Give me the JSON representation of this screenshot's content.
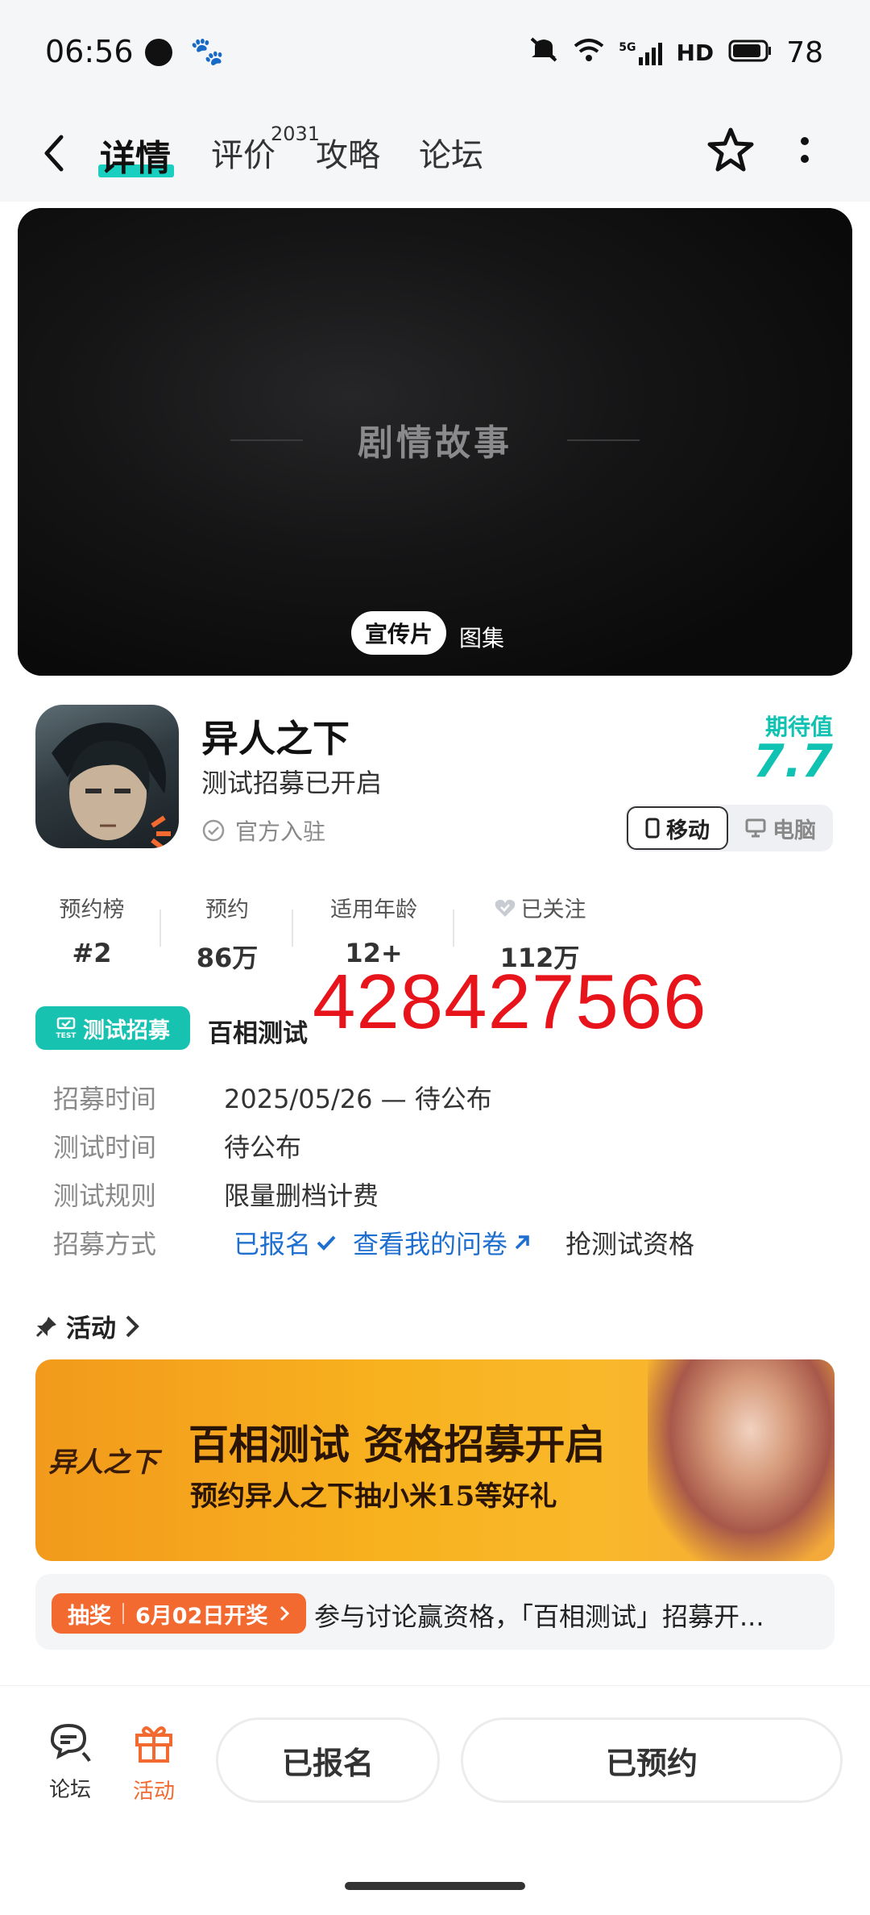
{
  "status_bar": {
    "time": "06:56",
    "network": "5G",
    "hd": "HD",
    "battery": "78"
  },
  "nav": {
    "tabs": [
      {
        "label": "详情",
        "active": true
      },
      {
        "label": "评价",
        "badge": "2031"
      },
      {
        "label": "攻略"
      },
      {
        "label": "论坛"
      }
    ]
  },
  "media": {
    "title_text": "剧情故事",
    "tab_video": "宣传片",
    "tab_gallery": "图集"
  },
  "game": {
    "name": "异人之下",
    "subtitle": "测试招募已开启",
    "verified": "官方入驻",
    "expect_label": "期待值",
    "expect_value": "7.7",
    "platform_mobile": "移动",
    "platform_pc": "电脑"
  },
  "stats": [
    {
      "label": "预约榜",
      "value": "#2"
    },
    {
      "label": "预约",
      "value": "86万"
    },
    {
      "label": "适用年龄",
      "value": "12+"
    },
    {
      "label": "已关注",
      "value": "112万"
    }
  ],
  "recruit": {
    "badge": "测试招募",
    "badge_icon_text": "TEST",
    "name": "百相测试",
    "overlay_number": "428427566",
    "rows": [
      {
        "label": "招募时间",
        "value": "2025/05/26 — 待公布"
      },
      {
        "label": "测试时间",
        "value": "待公布"
      },
      {
        "label": "测试规则",
        "value": "限量删档计费"
      }
    ],
    "method_label": "招募方式",
    "registered": "已报名",
    "view_survey": "查看我的问卷",
    "grab": "抢测试资格"
  },
  "activity": {
    "title": "活动",
    "banner_logo": "异人之下",
    "banner_line1": "百相测试 资格招募开启",
    "banner_line2": "预约异人之下抽小米15等好礼",
    "lottery_tag": "抽奖",
    "lottery_date": "6月02日开奖",
    "lottery_text": "参与讨论赢资格，「百相测试」招募开..."
  },
  "bottom": {
    "forum": "论坛",
    "activity": "活动",
    "registered_btn": "已报名",
    "reserved_btn": "已预约"
  },
  "colors": {
    "accent": "#19d0c0",
    "orange": "#f36a30",
    "overlay_red": "#e8141b",
    "link_blue": "#1e6fd0"
  }
}
